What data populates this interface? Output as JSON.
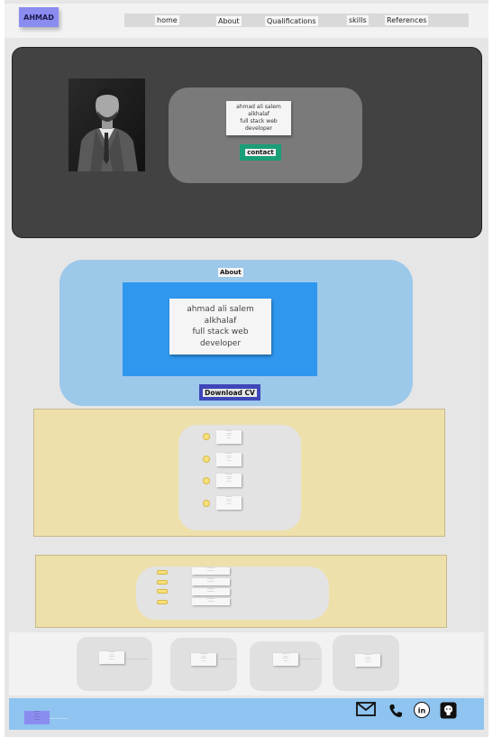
{
  "header": {
    "logo": "AHMAD",
    "nav": [
      "home",
      "About",
      "Qualifications",
      "skills",
      "References"
    ]
  },
  "hero": {
    "card_lines": [
      "ahmad ali salem",
      "alkhalaf",
      "full stack web",
      "developer"
    ],
    "contact_label": "contact"
  },
  "about": {
    "title": "About",
    "lines": [
      "ahmad ali salem",
      "alkhalaf",
      "full stack web",
      "developer"
    ],
    "download_label": "Download CV"
  },
  "qualifications": {
    "items": [
      [
        "-----------",
        "--------",
        "-------",
        "-------"
      ],
      [
        "-----------",
        "--------",
        "-------",
        "-------"
      ],
      [
        "-----------",
        "--------",
        "-------",
        "-------"
      ],
      [
        "-----------",
        "--------",
        "-------",
        "-------"
      ]
    ]
  },
  "skills": {
    "items": [
      [
        "------------",
        "----------"
      ],
      [
        "------------",
        "----------"
      ],
      [
        "------------",
        "----------"
      ],
      [
        "------------",
        "----------"
      ]
    ]
  },
  "references": {
    "items": [
      [
        "-----------",
        "------",
        "----------",
        "-------"
      ],
      [
        "-----------",
        "------",
        "----------",
        "-------"
      ],
      [
        "-----------",
        "------",
        "----------",
        "-------"
      ],
      [
        "-----------",
        "------",
        "----------",
        "-------"
      ]
    ]
  },
  "footer": {
    "logo_lines": [
      "--------",
      "-------",
      "----------",
      "-------"
    ],
    "icons": [
      "mail-icon",
      "phone-icon",
      "linkedin-icon",
      "github-icon"
    ]
  },
  "colors": {
    "logo": "#8b8cf0",
    "hero_bg": "#424242",
    "contact": "#1a9e78",
    "about_bg": "#9cc8ea",
    "about_box": "#2f97ee",
    "cv_button": "#3e46b8",
    "section_yellow": "#eee0aa",
    "footer": "#8ec4ef"
  }
}
